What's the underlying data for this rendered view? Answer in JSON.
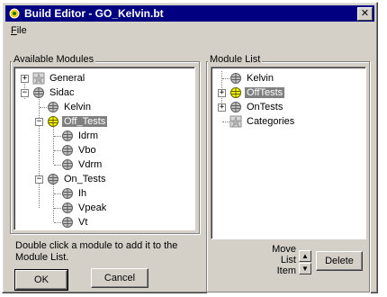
{
  "window": {
    "title": "Build Editor - GO_Kelvin.bt",
    "close_glyph": "✕"
  },
  "menu": [
    {
      "label": "File",
      "accel": "F",
      "rest": "ile"
    }
  ],
  "available": {
    "label": "Available Modules",
    "nodes": [
      {
        "label": "General",
        "icon": "category-icon",
        "expander": "+"
      },
      {
        "label": "Sidac",
        "icon": "module-icon",
        "expander": "−"
      },
      {
        "label": "Kelvin",
        "icon": "module-icon"
      },
      {
        "label": "Off_Tests",
        "icon": "module-icon-yellow",
        "expander": "−",
        "selected": true
      },
      {
        "label": "Idrm",
        "icon": "module-icon"
      },
      {
        "label": "Vbo",
        "icon": "module-icon"
      },
      {
        "label": "Vdrm",
        "icon": "module-icon"
      },
      {
        "label": "On_Tests",
        "icon": "module-icon",
        "expander": "−"
      },
      {
        "label": "Ih",
        "icon": "module-icon"
      },
      {
        "label": "Vpeak",
        "icon": "module-icon"
      },
      {
        "label": "Vt",
        "icon": "module-icon"
      }
    ],
    "help": "Double click a module to add it to the Module List."
  },
  "module_list": {
    "label": "Module List",
    "nodes": [
      {
        "label": "Kelvin",
        "icon": "module-icon"
      },
      {
        "label": "OffTests",
        "icon": "module-icon-yellow",
        "expander": "+",
        "selected": true
      },
      {
        "label": "OnTests",
        "icon": "module-icon",
        "expander": "+"
      },
      {
        "label": "Categories",
        "icon": "category-icon"
      }
    ]
  },
  "buttons": {
    "ok": "OK",
    "cancel": "Cancel",
    "delete": "Delete"
  },
  "move": {
    "line1": "Move",
    "line2": "List",
    "line3": "Item",
    "up": "▲",
    "down": "▼"
  },
  "colors": {
    "titlebar": "#000080",
    "face": "#d4d0c8",
    "selection": "#808080"
  }
}
